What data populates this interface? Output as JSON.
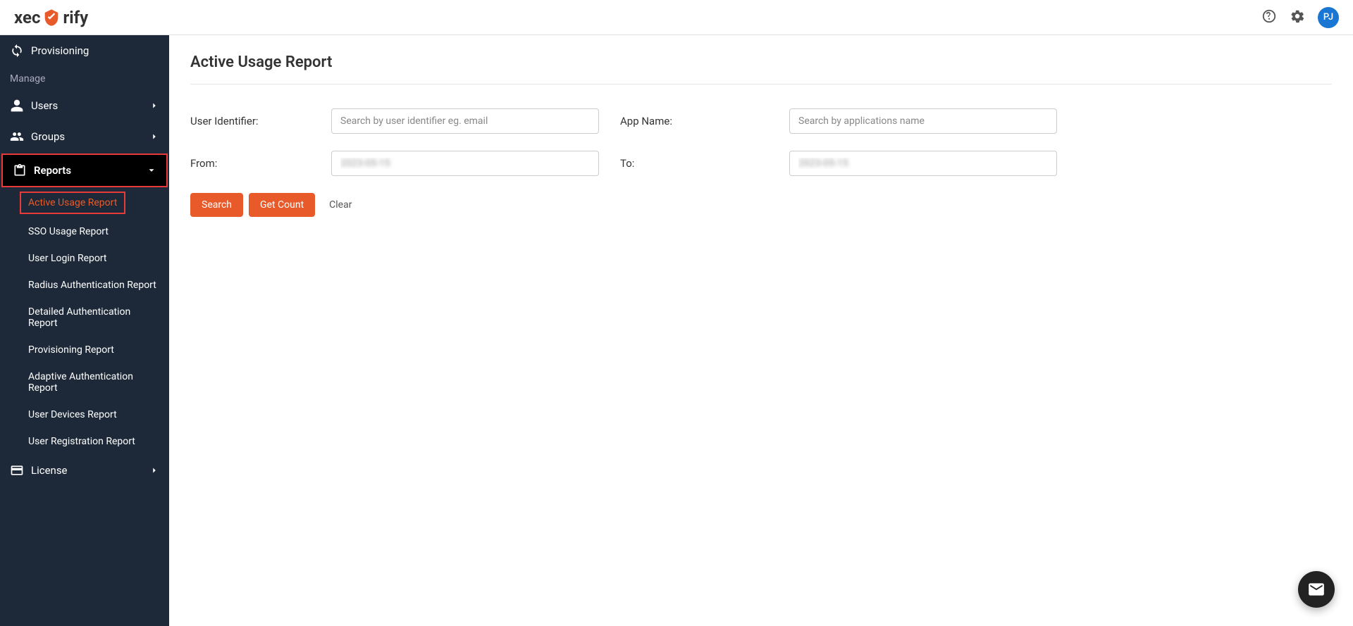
{
  "brand": {
    "name": "Xecurify"
  },
  "header": {
    "avatar_initials": "PJ"
  },
  "sidebar": {
    "provisioning_label": "Provisioning",
    "manage_label": "Manage",
    "users_label": "Users",
    "groups_label": "Groups",
    "reports_label": "Reports",
    "license_label": "License",
    "report_items": [
      {
        "label": "Active Usage Report"
      },
      {
        "label": "SSO Usage Report"
      },
      {
        "label": "User Login Report"
      },
      {
        "label": "Radius Authentication Report"
      },
      {
        "label": "Detailed Authentication Report"
      },
      {
        "label": "Provisioning Report"
      },
      {
        "label": "Adaptive Authentication Report"
      },
      {
        "label": "User Devices Report"
      },
      {
        "label": "User Registration Report"
      }
    ]
  },
  "page": {
    "title": "Active Usage Report"
  },
  "filters": {
    "user_identifier_label": "User Identifier:",
    "user_identifier_placeholder": "Search by user identifier eg. email",
    "app_name_label": "App Name:",
    "app_name_placeholder": "Search by applications name",
    "from_label": "From:",
    "from_value": "2023-05-15",
    "to_label": "To:",
    "to_value": "2023-05-15"
  },
  "actions": {
    "search_label": "Search",
    "get_count_label": "Get Count",
    "clear_label": "Clear"
  }
}
